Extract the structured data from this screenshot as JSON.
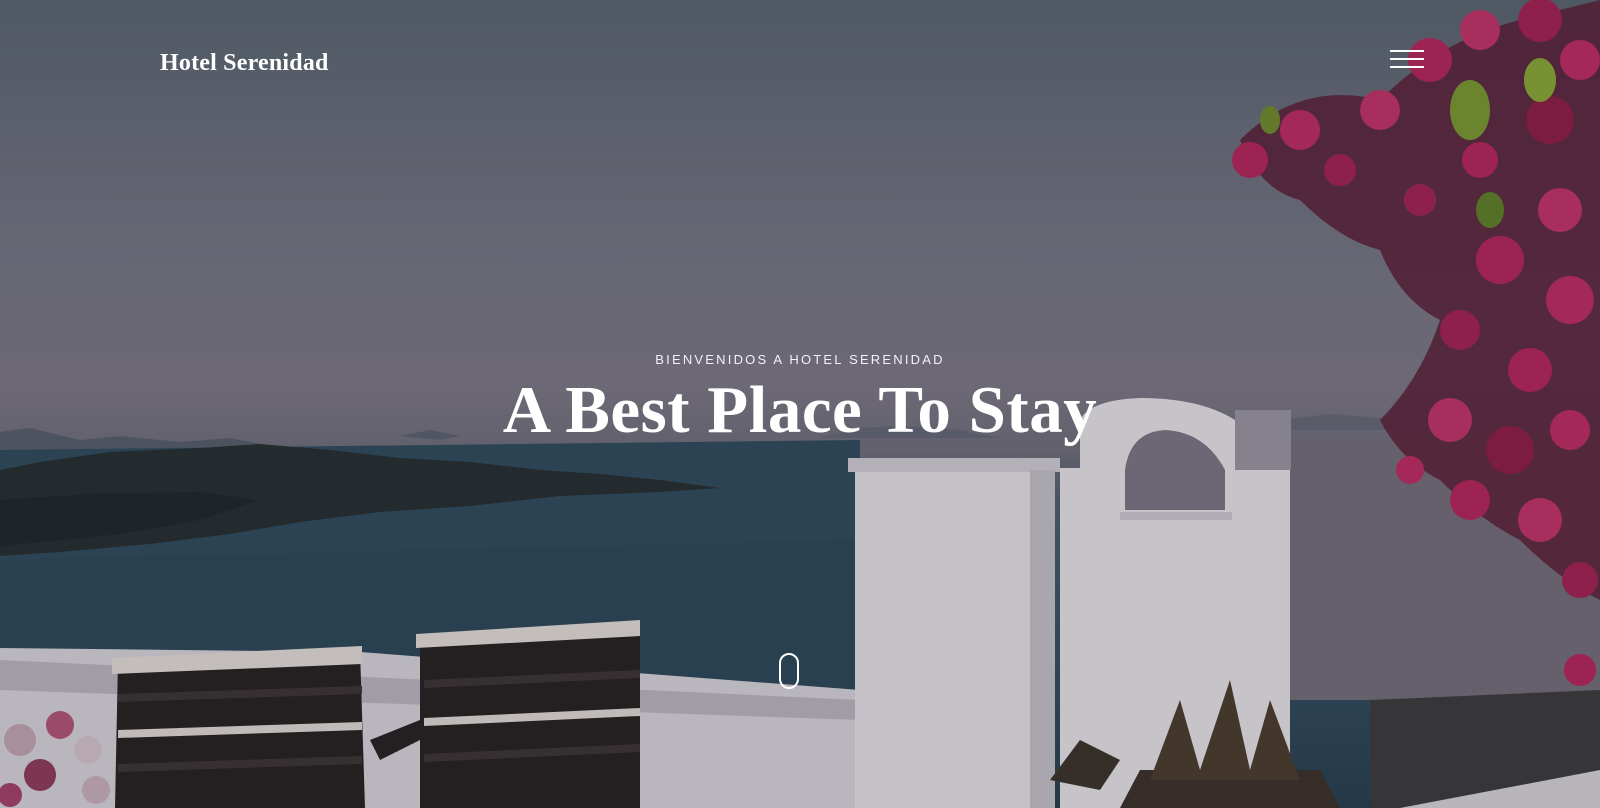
{
  "header": {
    "brand": "Hotel Serenidad",
    "menu_icon": "hamburger-menu-icon"
  },
  "hero": {
    "subtitle": "BIENVENIDOS A HOTEL SERENIDAD",
    "title": "A Best Place To Stay",
    "scroll_icon": "mouse-scroll-icon"
  },
  "colors": {
    "text": "#ffffff",
    "flowers": "#b8245a",
    "sea": "#2f4b5d"
  }
}
